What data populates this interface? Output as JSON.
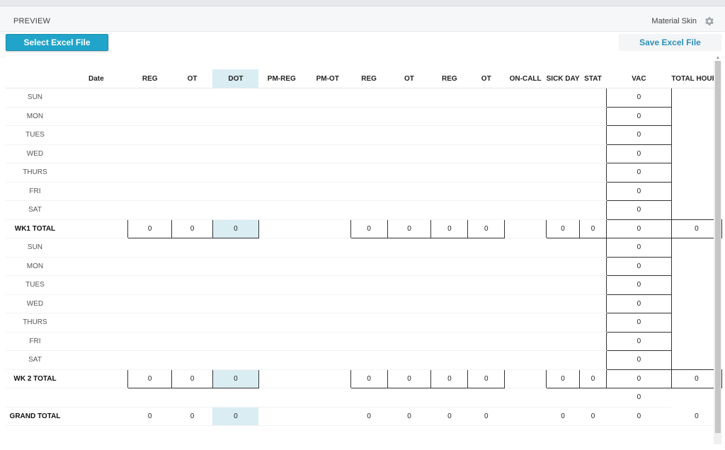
{
  "header": {
    "preview_label": "PREVIEW",
    "skin_label": "Material Skin",
    "settings_icon": "gear-icon"
  },
  "toolbar": {
    "select_label": "Select Excel File",
    "save_label": "Save Excel File"
  },
  "colors": {
    "accent": "#21a4c9",
    "dot_highlight": "#daedf3",
    "save_text": "#2a8fb8"
  },
  "columns": [
    "Date",
    "REG",
    "OT",
    "DOT",
    "PM-REG",
    "PM-OT",
    "REG",
    "OT",
    "REG",
    "OT",
    "ON-CALL",
    "SICK DAY",
    "STAT",
    "VAC",
    "TOTAL HOURS"
  ],
  "week1": {
    "days": [
      "SUN",
      "MON",
      "TUES",
      "WED",
      "THURS",
      "FRI",
      "SAT"
    ],
    "day_totals": [
      "0",
      "0",
      "0",
      "0",
      "0",
      "0",
      "0"
    ],
    "total_label": "WK1 TOTAL",
    "totals": {
      "reg": "0",
      "ot": "0",
      "dot": "0",
      "reg2": "0",
      "ot2": "0",
      "reg3": "0",
      "ot3": "0",
      "sick": "0",
      "stat": "0",
      "vac": "0",
      "total": "0"
    }
  },
  "week2": {
    "days": [
      "SUN",
      "MON",
      "TUES",
      "WED",
      "THURS",
      "FRI",
      "SAT"
    ],
    "day_totals": [
      "0",
      "0",
      "0",
      "0",
      "0",
      "0",
      "0"
    ],
    "total_label": "WK 2 TOTAL",
    "totals": {
      "reg": "0",
      "ot": "0",
      "dot": "0",
      "reg2": "0",
      "ot2": "0",
      "reg3": "0",
      "ot3": "0",
      "sick": "0",
      "stat": "0",
      "vac": "0",
      "total": "0"
    }
  },
  "blank_row_total": "0",
  "grand": {
    "label": "GRAND TOTAL",
    "totals": {
      "reg": "0",
      "ot": "0",
      "dot": "0",
      "reg2": "0",
      "ot2": "0",
      "reg3": "0",
      "ot3": "0",
      "sick": "0",
      "stat": "0",
      "vac": "0",
      "total": "0"
    }
  }
}
